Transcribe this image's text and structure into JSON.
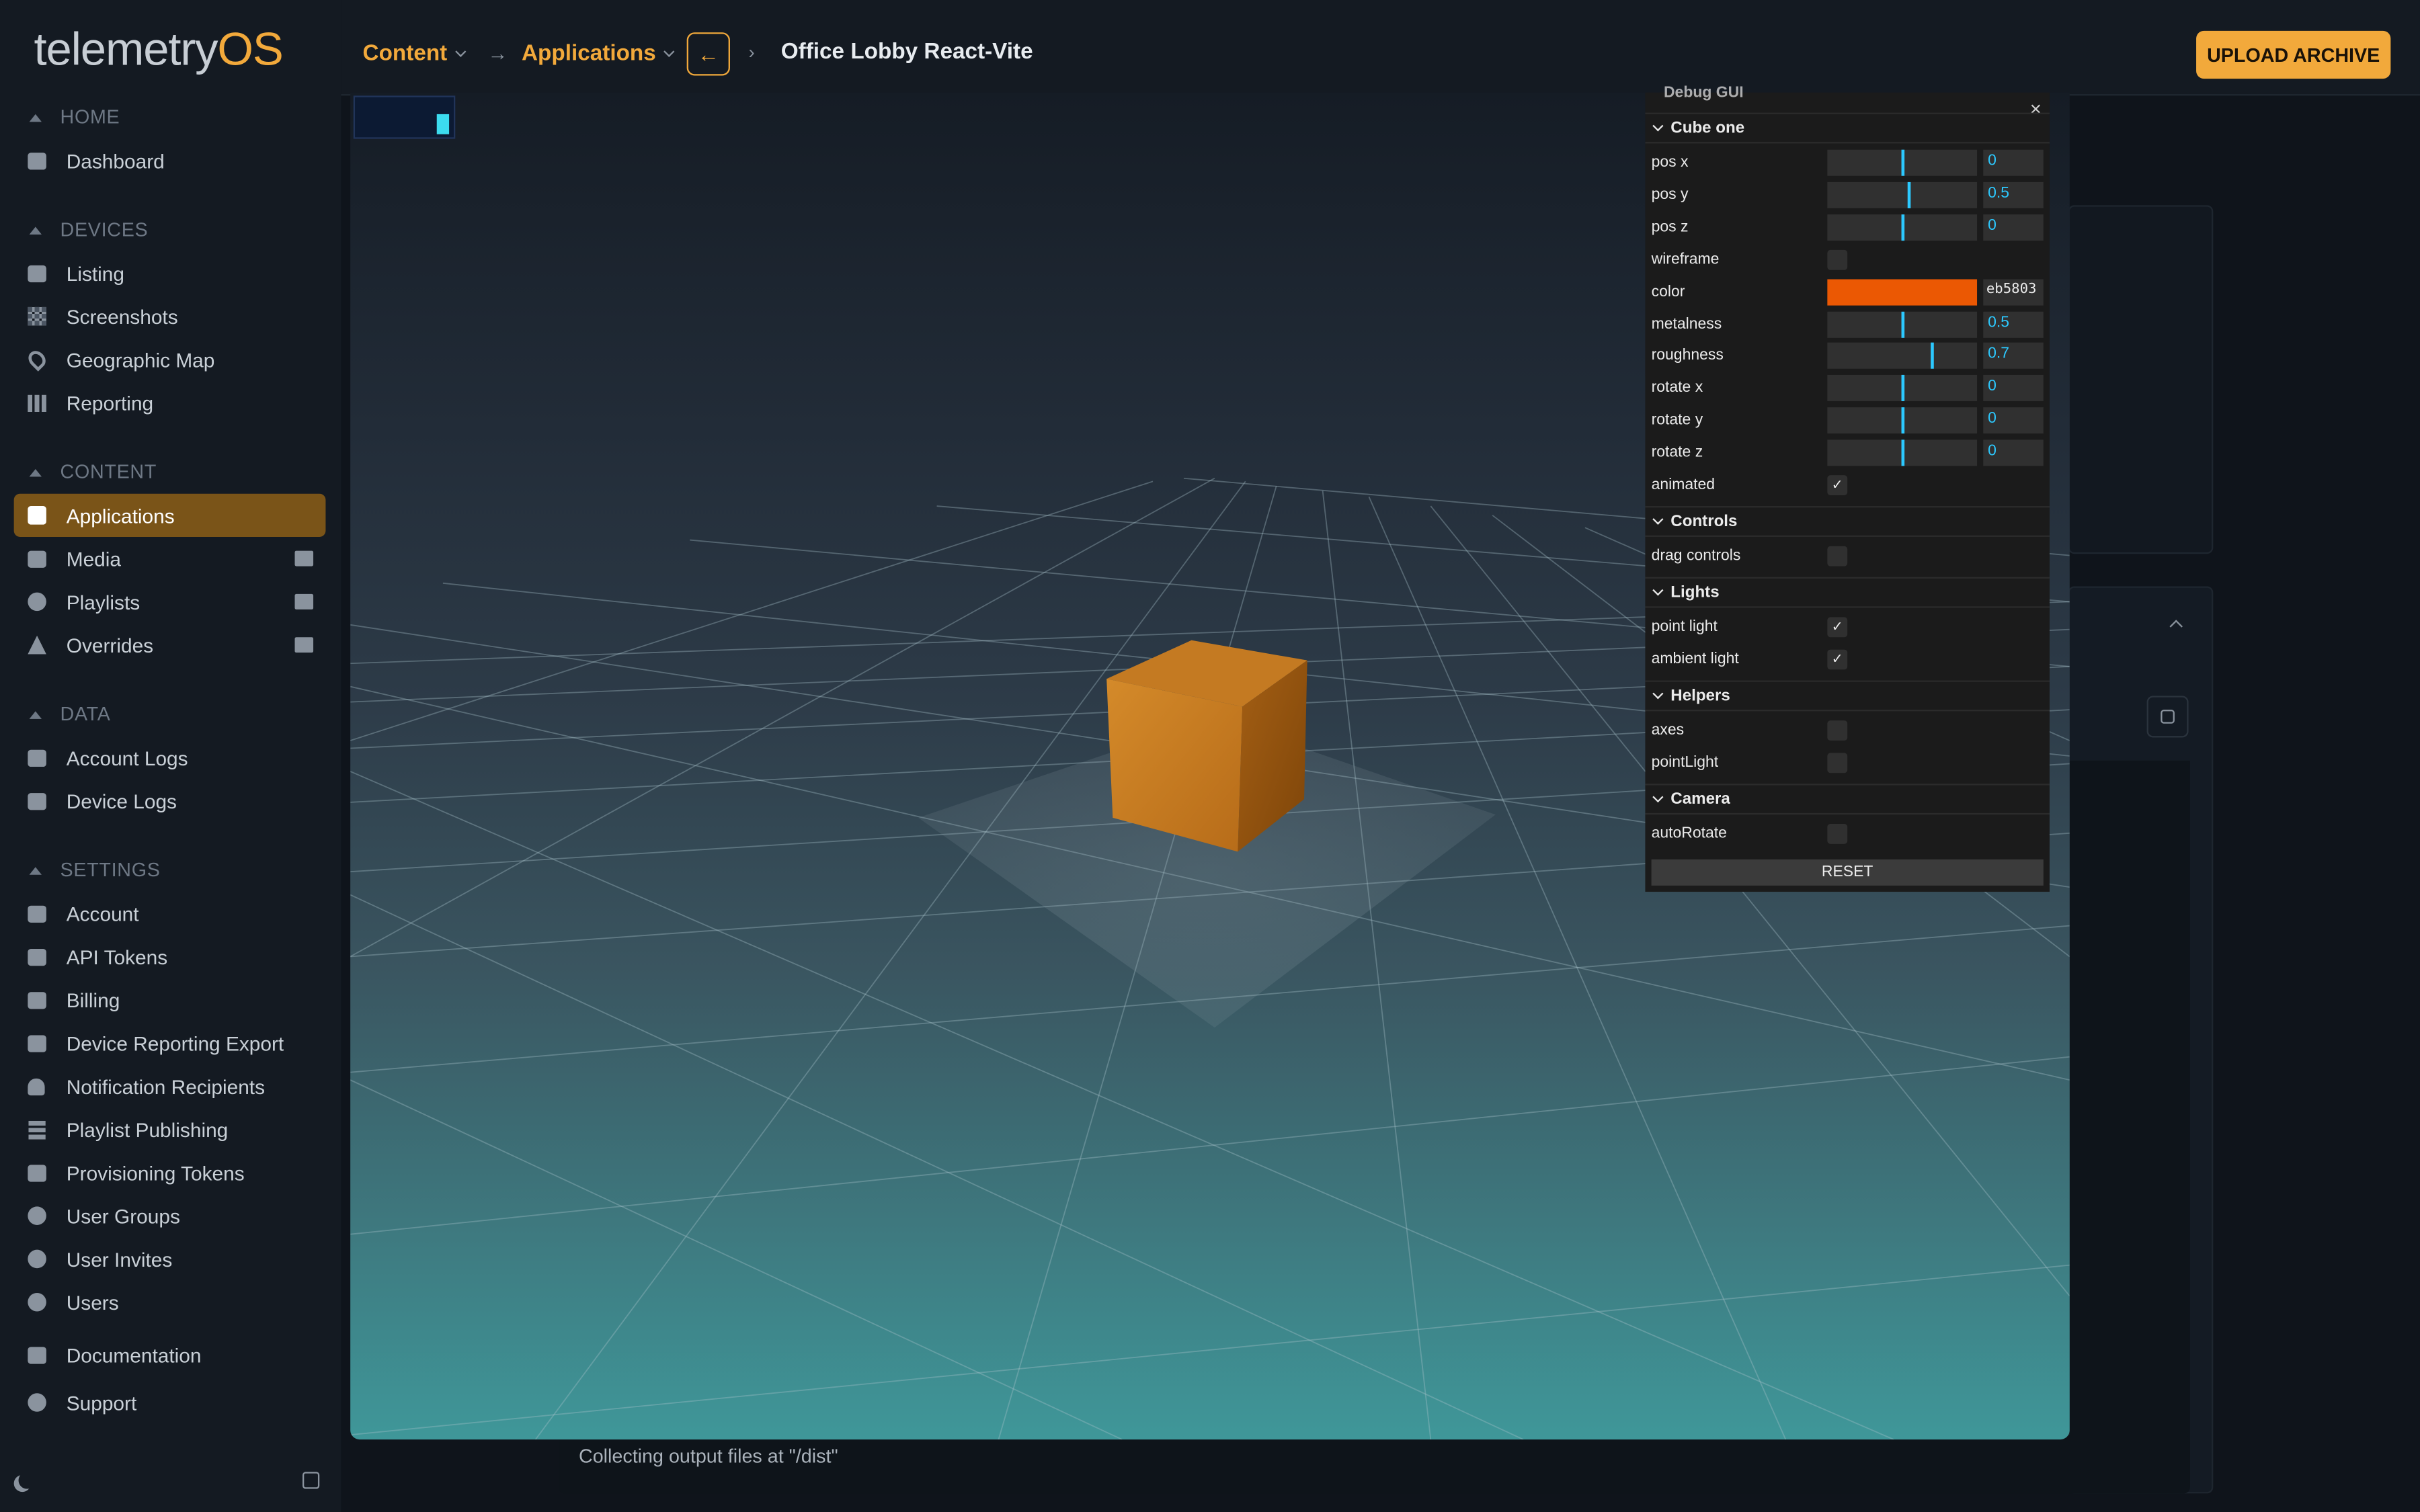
{
  "logo": {
    "main": "telemetry",
    "accent": "OS"
  },
  "sidebar": {
    "sections": [
      {
        "title": "HOME",
        "items": [
          {
            "label": "Dashboard",
            "icon": "dashboard-icon"
          }
        ]
      },
      {
        "title": "DEVICES",
        "items": [
          {
            "label": "Listing",
            "icon": "monitor-icon"
          },
          {
            "label": "Screenshots",
            "icon": "grid-icon"
          },
          {
            "label": "Geographic Map",
            "icon": "map-pin-icon"
          },
          {
            "label": "Reporting",
            "icon": "bar-chart-icon"
          }
        ]
      },
      {
        "title": "CONTENT",
        "items": [
          {
            "label": "Applications",
            "icon": "cube-icon",
            "active": true
          },
          {
            "label": "Media",
            "icon": "image-icon"
          },
          {
            "label": "Playlists",
            "icon": "playlist-icon"
          },
          {
            "label": "Overrides",
            "icon": "warning-icon"
          }
        ]
      },
      {
        "title": "DATA",
        "items": [
          {
            "label": "Account Logs",
            "icon": "log-icon"
          },
          {
            "label": "Device Logs",
            "icon": "log-icon"
          }
        ]
      },
      {
        "title": "SETTINGS",
        "items": [
          {
            "label": "Account",
            "icon": "account-icon"
          },
          {
            "label": "API Tokens",
            "icon": "api-icon"
          },
          {
            "label": "Billing",
            "icon": "billing-icon"
          },
          {
            "label": "Device Reporting Export",
            "icon": "download-icon"
          },
          {
            "label": "Notification Recipients",
            "icon": "bell-icon"
          },
          {
            "label": "Playlist Publishing",
            "icon": "list-check-icon"
          },
          {
            "label": "Provisioning Tokens",
            "icon": "clipboard-icon"
          },
          {
            "label": "User Groups",
            "icon": "users-icon"
          },
          {
            "label": "User Invites",
            "icon": "user-plus-icon"
          },
          {
            "label": "Users",
            "icon": "user-icon"
          }
        ]
      }
    ],
    "footer": [
      {
        "label": "Documentation",
        "icon": "book-icon"
      },
      {
        "label": "Support",
        "icon": "support-icon"
      }
    ]
  },
  "header": {
    "crumb1": "Content",
    "crumb2": "Applications",
    "back": "←",
    "title": "Office Lobby React-Vite",
    "upload": "UPLOAD ARCHIVE"
  },
  "background": {
    "log_line": "Collecting output files at \"/dist\""
  },
  "gui": {
    "title": "Debug GUI",
    "folders": {
      "cube": "Cube one",
      "controls": "Controls",
      "lights": "Lights",
      "helpers": "Helpers",
      "camera": "Camera"
    },
    "cube_rows": [
      {
        "label": "pos x",
        "value": "0",
        "fraction": 0.5
      },
      {
        "label": "pos y",
        "value": "0.5",
        "fraction": 0.55
      },
      {
        "label": "pos z",
        "value": "0",
        "fraction": 0.5
      },
      {
        "label": "wireframe",
        "checked": false
      },
      {
        "label": "color",
        "value": "eb5803"
      },
      {
        "label": "metalness",
        "value": "0.5",
        "fraction": 0.5
      },
      {
        "label": "roughness",
        "value": "0.7",
        "fraction": 0.7
      },
      {
        "label": "rotate x",
        "value": "0",
        "fraction": 0.5
      },
      {
        "label": "rotate y",
        "value": "0",
        "fraction": 0.5
      },
      {
        "label": "rotate z",
        "value": "0",
        "fraction": 0.5
      },
      {
        "label": "animated",
        "checked": true
      }
    ],
    "drag_controls": {
      "label": "drag controls",
      "checked": false
    },
    "point_light": {
      "label": "point light",
      "checked": true
    },
    "ambient_light": {
      "label": "ambient light",
      "checked": true
    },
    "axes": {
      "label": "axes",
      "checked": false
    },
    "point_light_helper": {
      "label": "pointLight",
      "checked": false
    },
    "auto_rotate": {
      "label": "autoRotate",
      "checked": false
    },
    "reset": "RESET",
    "check_glyph": "✓",
    "close_glyph": "×"
  },
  "colors": {
    "accent": "#f2a93b",
    "cube": "#eb5803",
    "slider": "#2cc9ff"
  }
}
